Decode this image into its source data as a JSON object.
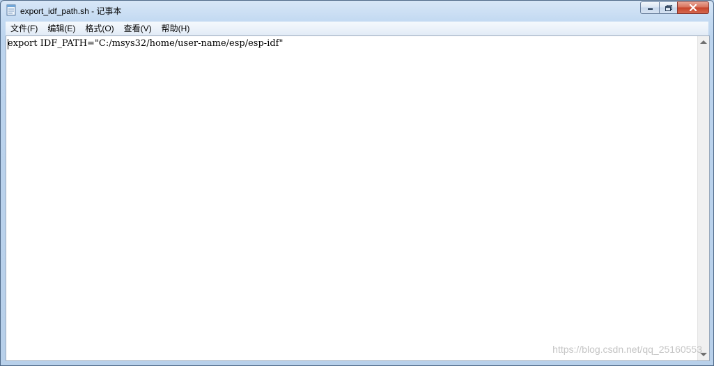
{
  "window": {
    "title": "export_idf_path.sh - 记事本",
    "icon": "notepad-icon"
  },
  "caption_buttons": {
    "minimize_icon": "minimize-icon",
    "maximize_icon": "restore-icon",
    "close_icon": "close-icon"
  },
  "menu": {
    "items": [
      "文件(F)",
      "编辑(E)",
      "格式(O)",
      "查看(V)",
      "帮助(H)"
    ]
  },
  "editor": {
    "content": "export IDF_PATH=\"C:/msys32/home/user-name/esp/esp-idf\""
  },
  "watermark": "https://blog.csdn.net/qq_25160553",
  "colors": {
    "title_bar": "#c5dbf2",
    "close_button": "#c7432a",
    "editor_background": "#ffffff"
  }
}
